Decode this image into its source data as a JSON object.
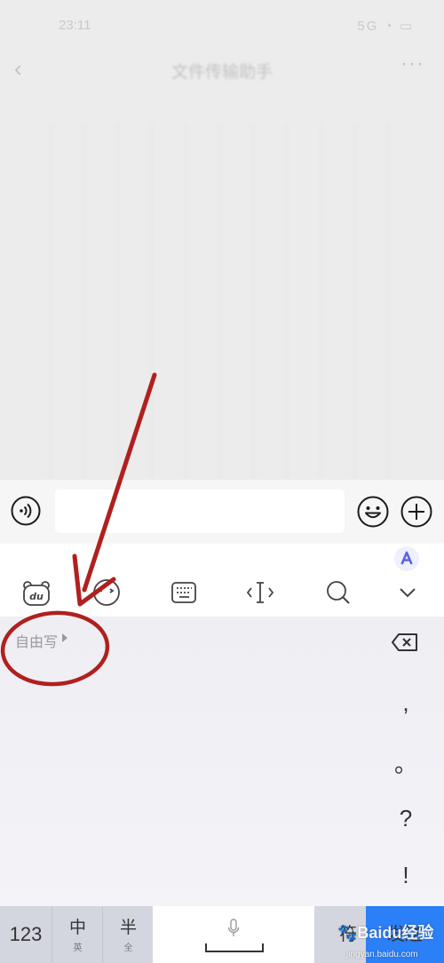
{
  "status_bar": {
    "time": "23:11",
    "indicators": "5G ◔ ▭"
  },
  "nav": {
    "back_icon": "chevron-left-icon",
    "title": "文件传输助手",
    "more": "···"
  },
  "input_bar": {
    "voice_icon": "voice-icon",
    "field_value": "",
    "emoji_icon": "emoji-icon",
    "plus_icon": "plus-icon"
  },
  "toolbar": {
    "icons": [
      "du-bear-icon",
      "face-emoji-icon",
      "keyboard-icon",
      "cursor-icon",
      "search-icon",
      "chevron-down-icon"
    ],
    "ai_badge": "A"
  },
  "keyboard": {
    "free_write": "自由写",
    "punctuation": [
      ",",
      "。",
      "?",
      "!"
    ],
    "keys": {
      "num": "123",
      "zh_main": "中",
      "zh_sub": "英",
      "half_main": "半",
      "half_sub": "全",
      "symbol": "符",
      "send": "发送"
    }
  },
  "watermark": {
    "brand": "Baidu经验",
    "url": "jingyan.baidu.com"
  },
  "colors": {
    "send_key": "#2b7ff7",
    "annotation": "#b0201e"
  }
}
